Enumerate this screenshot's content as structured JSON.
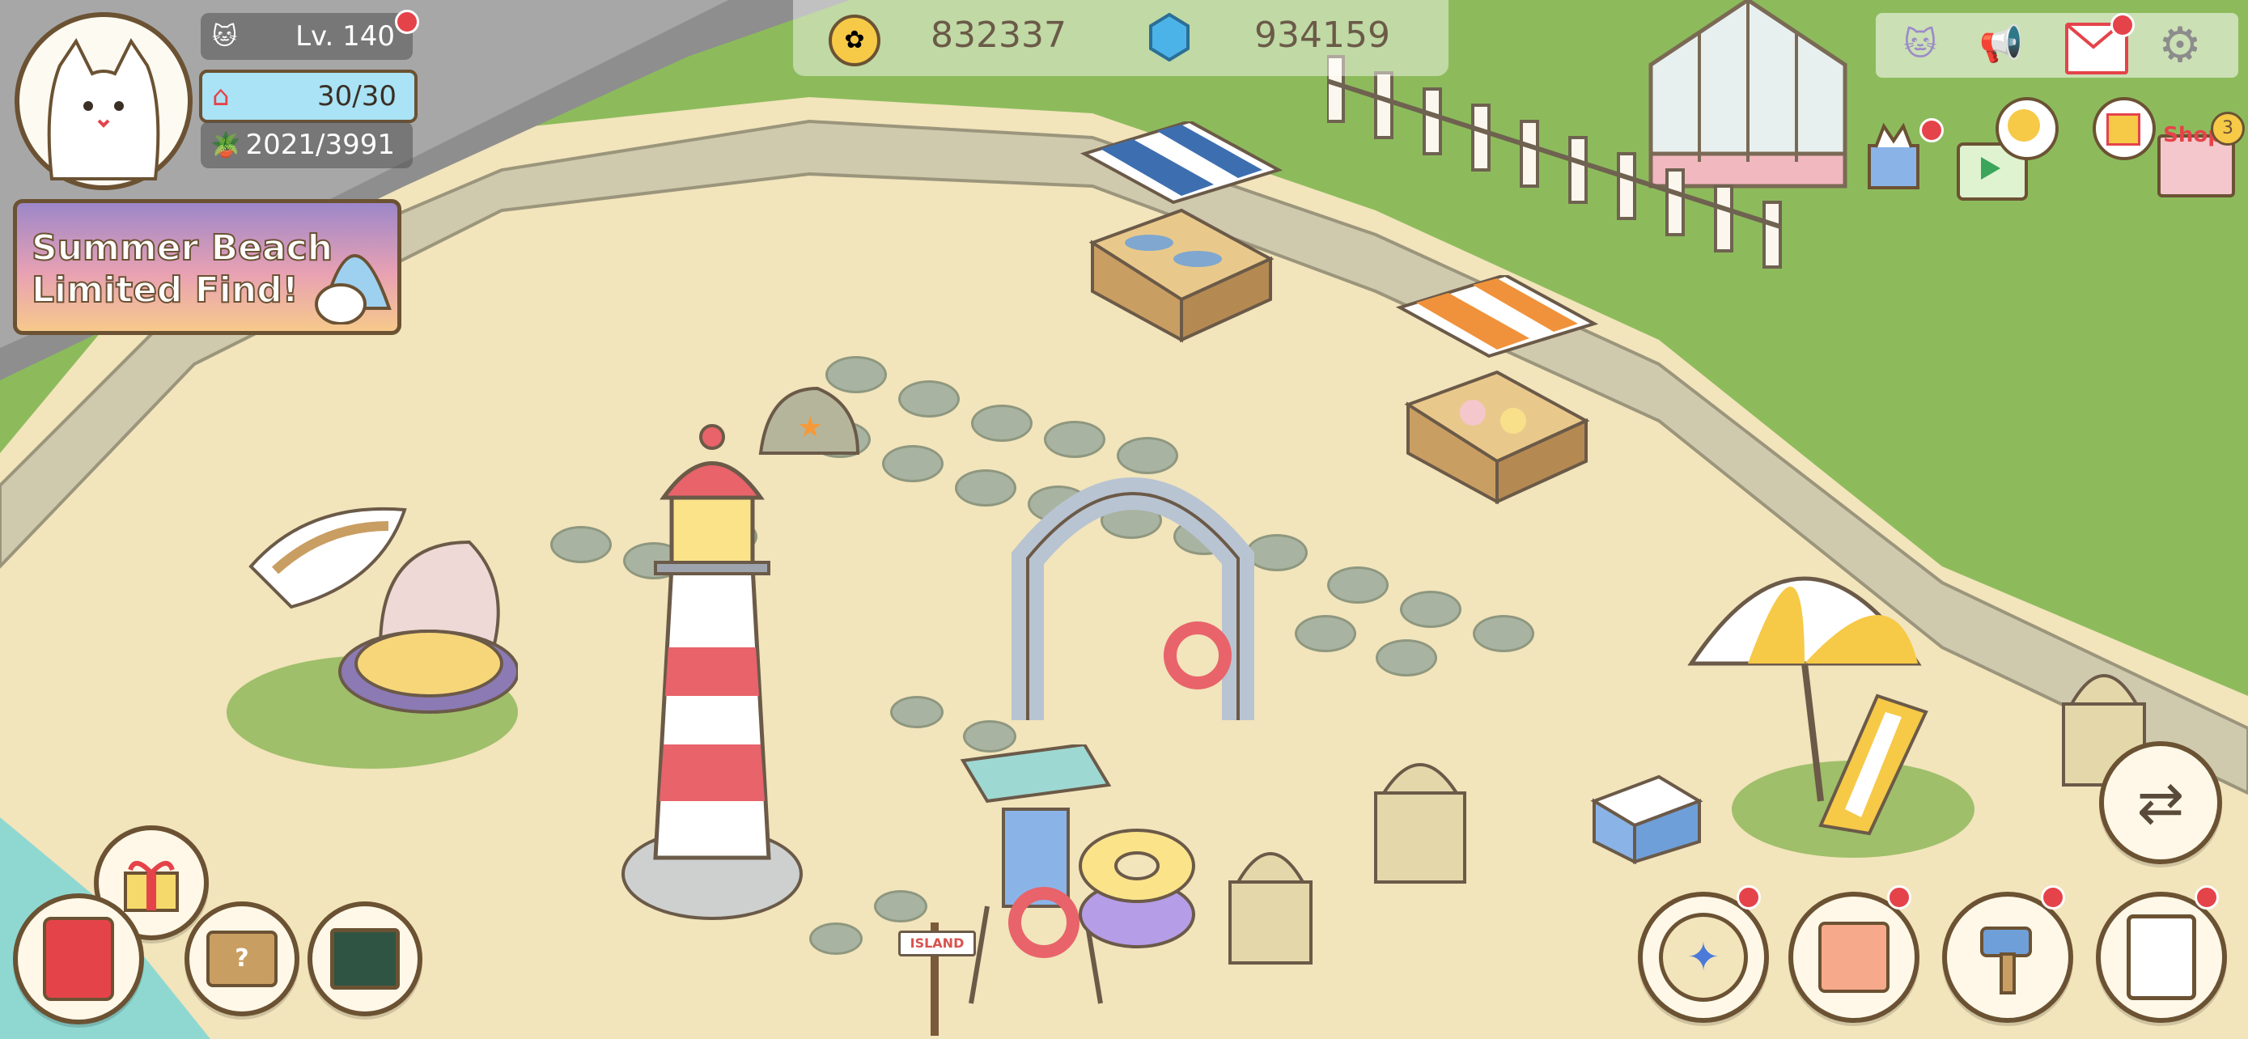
{
  "player": {
    "level_text": "Lv. 140",
    "housing": "30/30",
    "plants": "2021/3991"
  },
  "currency": {
    "coins": "832337",
    "gems": "934159"
  },
  "event_banner": {
    "line1": "Summer Beach",
    "line2": "Limited Find!"
  },
  "shop": {
    "label": "Shop",
    "badge": "3"
  },
  "sign_label": "ISLAND",
  "colors": {
    "sand": "#f2e4bb",
    "grass": "#8dbb5c",
    "cliff": "#cfc9ae",
    "hud_blue": "#a9e3f5",
    "notify_red": "#e5434a",
    "button_brown": "#6b5233"
  },
  "icons": [
    "cat-avatar-icon",
    "cat-level-icon",
    "house-icon",
    "plant-icon",
    "coin-icon",
    "gem-icon",
    "friends-icon",
    "megaphone-icon",
    "mail-icon",
    "gear-icon",
    "cat-gift-icon",
    "video-play-icon",
    "coin-bubble-icon",
    "gift-bubble-icon",
    "shop-icon",
    "gift-icon",
    "diary-icon",
    "storage-box-icon",
    "collection-board-icon",
    "compass-icon",
    "gift-box-icon",
    "hammer-icon",
    "clipboard-icon",
    "swap-mode-icon"
  ]
}
